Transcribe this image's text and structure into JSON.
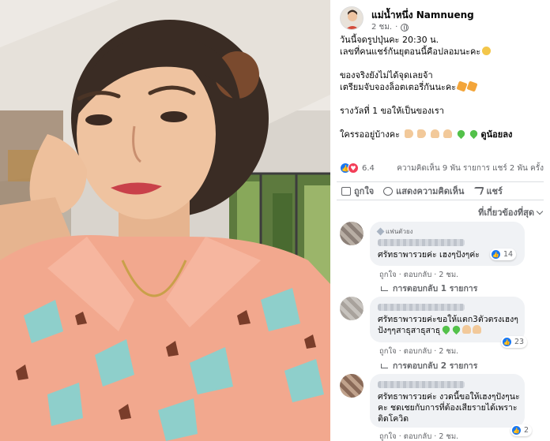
{
  "post": {
    "author": "แม่น้ำหนึ่ง Namnueng",
    "time": "2 ชม.",
    "lines": [
      "วันนี้จดรูปปุ่นคะ 20:30 น.",
      "เลขที่คนแชร์กันยุตอนนี้คือปลอมนะคะ"
    ],
    "lines2": [
      "ของจริงยังไม่ได้จุดเลยจ้า",
      "เตรียมจับจองล็อตเตอรี่กันนะคะ"
    ],
    "line3": "รางวัลที่ 1 ขอให้เป็นของเรา",
    "line4_prefix": "ใครรออยู่บ้างคะ",
    "line4_bold": "ดูน้อยลง"
  },
  "stats": {
    "reactions": "6.4",
    "comments_shares": "ความคิดเห็น 9 พัน รายการ  แชร์ 2 พัน ครั้ง"
  },
  "actions": {
    "like": "ถูกใจ",
    "comment": "แสดงความคิดเห็น",
    "share": "แชร์"
  },
  "sort_label": "ที่เกี่ยวข้องที่สุด",
  "comments": [
    {
      "badge": "แฟนตัวยง",
      "text": [
        "ศรัทธาพารวยค่ะ เฮงๆปังๆค่ะ"
      ],
      "reactions": "14",
      "links": "ถูกใจ · ตอบกลับ · 2 ชม.",
      "replies": "การตอบกลับ 1 รายการ"
    },
    {
      "badge": "",
      "text": [
        "ศรัทธาพารวยค่ะขอให้แตก3ตัวตรงเฮงๆ",
        "ปังๆๆสาธุสาธุสาธุ"
      ],
      "reactions": "23",
      "links": "ถูกใจ · ตอบกลับ · 2 ชม.",
      "replies": "การตอบกลับ 2 รายการ"
    },
    {
      "badge": "",
      "text": [
        "ศรัทธาพารวยค่ะ งวดนี้ขอให้เฮงๆปังๆนะ",
        "คะ ชดเชยกับการที่ต้องเสียรายได้เพราะ",
        "ติดโควิด"
      ],
      "reactions": "2",
      "links": "ถูกใจ · ตอบกลับ · 2 ชม."
    }
  ],
  "colors": {
    "accent": "#1877f2",
    "love": "#f33e58",
    "shirt": "#f2a88e",
    "pattern": "#8ecfcb"
  }
}
